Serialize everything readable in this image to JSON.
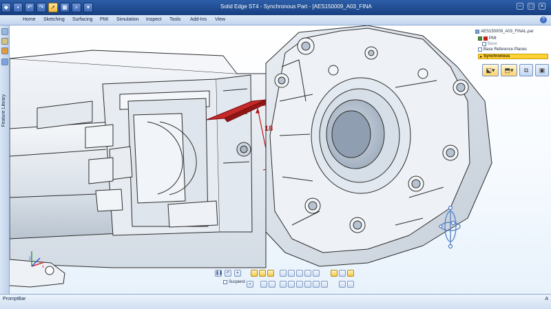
{
  "window": {
    "title": "Solid Edge ST4 - Synchronous Part - [AES150009_A03_FINAL.par]"
  },
  "quick_access": {
    "icons": [
      "app-menu-icon",
      "save-icon",
      "undo-icon",
      "redo-icon",
      "select-arrow-icon",
      "grid-icon",
      "zoom-icon",
      "customize-icon"
    ]
  },
  "ribbon": {
    "tabs": [
      "Home",
      "Sketching",
      "Surfacing",
      "PMI",
      "Simulation",
      "Inspect",
      "Tools",
      "Add-Ins",
      "View"
    ]
  },
  "left_panel": {
    "vertical_label": "Feature Library"
  },
  "pathfinder": {
    "file": "AES150009_A03_FINAL.par",
    "items": [
      {
        "label": "PMI"
      },
      {
        "label": "Base"
      },
      {
        "label": "Base Reference Planes"
      },
      {
        "label": "Synchronous"
      }
    ]
  },
  "model": {
    "dimension_value": "18"
  },
  "command_bar": {
    "suspend_label": "Suspend"
  },
  "prompt_bar": {
    "label": "PromptBar",
    "tools_text": "A"
  },
  "colors": {
    "title_bar": "#1f4a8f",
    "ribbon": "#d3e1f3",
    "highlight_face": "#c42a2a",
    "sync_highlight": "#ffd235",
    "model_fill": "#e6ebf1",
    "model_edge": "#2c2c2c"
  }
}
